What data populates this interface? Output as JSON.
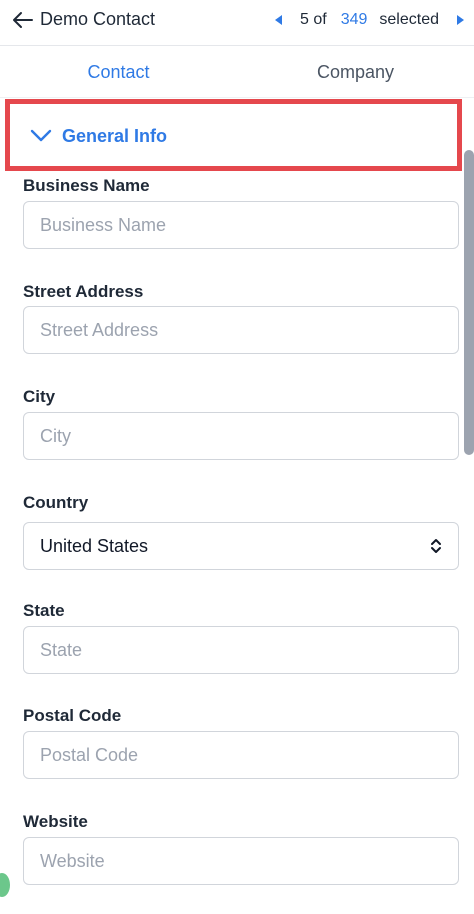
{
  "header": {
    "title": "Demo Contact",
    "pager": {
      "current": "5 of",
      "total": "349",
      "selected": "selected"
    }
  },
  "tabs": [
    {
      "label": "Contact",
      "active": true
    },
    {
      "label": "Company",
      "active": false
    }
  ],
  "section": {
    "title": "General Info",
    "highlight_color": "#e5484d"
  },
  "fields": {
    "business_name": {
      "label": "Business Name",
      "placeholder": "Business Name"
    },
    "street_address": {
      "label": "Street Address",
      "placeholder": "Street Address"
    },
    "city": {
      "label": "City",
      "placeholder": "City"
    },
    "country": {
      "label": "Country",
      "value": "United States"
    },
    "state": {
      "label": "State",
      "placeholder": "State"
    },
    "postal_code": {
      "label": "Postal Code",
      "placeholder": "Postal Code"
    },
    "website": {
      "label": "Website",
      "placeholder": "Website"
    }
  },
  "colors": {
    "accent": "#2f7ae5",
    "text": "#1f2937",
    "placeholder": "#9ca3af"
  }
}
